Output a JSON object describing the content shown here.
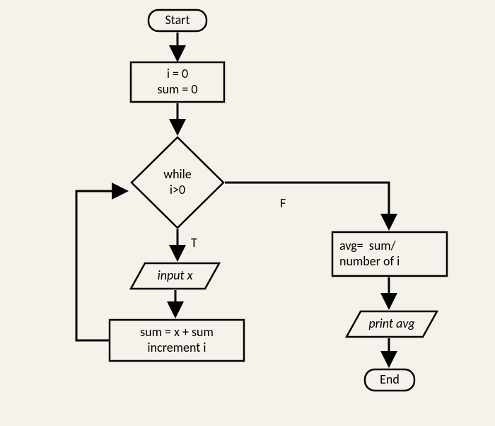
{
  "start": "Start",
  "init": "i = 0\nsum = 0",
  "decision": "while\ni>0",
  "label_true": "T",
  "label_false": "F",
  "input": "input x",
  "update": "sum = x + sum\nincrement i",
  "avg": "avg=  sum/\nnumber of i",
  "print": "print avg",
  "end": "End"
}
